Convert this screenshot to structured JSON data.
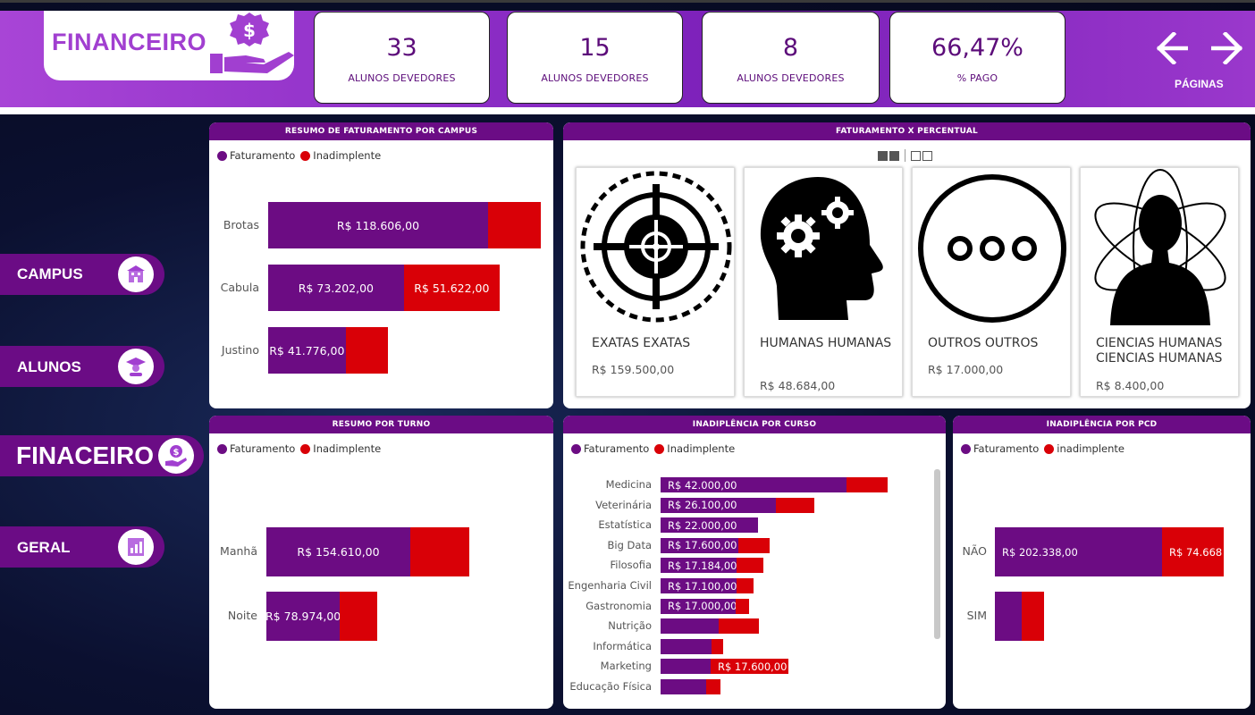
{
  "header": {
    "title": "FINANCEIRO",
    "kpis": [
      {
        "value": "33",
        "label": "ALUNOS DEVEDORES"
      },
      {
        "value": "15",
        "label": "ALUNOS DEVEDORES"
      },
      {
        "value": "8",
        "label": "ALUNOS DEVEDORES"
      },
      {
        "value": "66,47%",
        "label": "% PAGO"
      }
    ],
    "nav_label": "PÁGINAS"
  },
  "sidebar": {
    "items": [
      {
        "label": "CAMPUS",
        "icon": "building-icon"
      },
      {
        "label": "ALUNOS",
        "icon": "student-icon"
      },
      {
        "label": "FINACEIRO",
        "icon": "money-hand-icon"
      },
      {
        "label": "GERAL",
        "icon": "report-chart-icon"
      }
    ]
  },
  "colors": {
    "faturamento": "#6c0c83",
    "inadimplente": "#d90007",
    "header": "#6b0c85"
  },
  "campus_panel": {
    "title": "RESUMO DE FATURAMENTO POR CAMPUS",
    "legend": [
      "Faturamento",
      "Inadimplente"
    ]
  },
  "percent_panel": {
    "title": "FATURAMENTO X PERCENTUAL",
    "cards": [
      {
        "title": "EXATAS EXATAS",
        "value": "R$ 159.500,00",
        "icon": "target-icon"
      },
      {
        "title": "HUMANAS HUMANAS",
        "value": "R$ 48.684,00",
        "icon": "head-gears-icon"
      },
      {
        "title": "OUTROS OUTROS",
        "value": "R$ 17.000,00",
        "icon": "more-icon"
      },
      {
        "title": "CIENCIAS HUMANAS CIENCIAS HUMANAS",
        "value": "R$ 8.400,00",
        "icon": "atom-person-icon"
      }
    ]
  },
  "turno_panel": {
    "title": "RESUMO POR TURNO",
    "legend": [
      "Faturamento",
      "Inadimplente"
    ]
  },
  "curso_panel": {
    "title": "INADIPLÊNCIA POR CURSO",
    "legend": [
      "Faturamento",
      "Inadimplente"
    ]
  },
  "pcd_panel": {
    "title": "INADIPLÊNCIA POR PCD",
    "legend": [
      "Faturamento",
      "inadimplente"
    ]
  },
  "chart_data": [
    {
      "type": "bar",
      "title": "RESUMO DE FATURAMENTO POR CAMPUS",
      "categories": [
        "Brotas",
        "Cabula",
        "Justino"
      ],
      "series": [
        {
          "name": "Faturamento",
          "values": [
            118606,
            73202,
            41776
          ],
          "labels": [
            "R$ 118.606,00",
            "R$ 73.202,00",
            "R$ 41.776,00"
          ]
        },
        {
          "name": "Inadimplente",
          "values": [
            28500,
            51622,
            23000
          ],
          "labels": [
            "",
            "R$ 51.622,00",
            ""
          ]
        }
      ]
    },
    {
      "type": "bar",
      "title": "RESUMO POR TURNO",
      "categories": [
        "Manhã",
        "Noite"
      ],
      "series": [
        {
          "name": "Faturamento",
          "values": [
            154610,
            78974
          ],
          "labels": [
            "R$ 154.610,00",
            "R$ 78.974,00"
          ]
        },
        {
          "name": "Inadimplente",
          "values": [
            63000,
            40000
          ],
          "labels": [
            "",
            ""
          ]
        }
      ]
    },
    {
      "type": "bar",
      "title": "INADIPLÊNCIA POR CURSO",
      "categories": [
        "Medicina",
        "Veterinária",
        "Estatística",
        "Big Data",
        "Filosofia",
        "Engenharia Civil",
        "Gastronomia",
        "Nutrição",
        "Informática",
        "Marketing",
        "Educação Física"
      ],
      "series": [
        {
          "name": "Faturamento",
          "values": [
            42000,
            26100,
            22000,
            17600,
            17184,
            17100,
            17000,
            13200,
            11500,
            11300,
            10300
          ],
          "labels": [
            "R$ 42.000,00",
            "R$ 26.100,00",
            "R$ 22.000,00",
            "R$ 17.600,00",
            "R$ 17.184,00",
            "R$ 17.100,00",
            "R$ 17.000,00",
            "",
            "",
            "",
            ""
          ]
        },
        {
          "name": "Inadimplente",
          "values": [
            9300,
            8600,
            0,
            7100,
            6000,
            4000,
            3000,
            9000,
            2600,
            17600,
            3200
          ],
          "labels": [
            "",
            "",
            "",
            "",
            "",
            "",
            "",
            "",
            "",
            "R$ 17.600,00",
            ""
          ]
        }
      ]
    },
    {
      "type": "bar",
      "title": "INADIPLÊNCIA POR PCD",
      "categories": [
        "NÃO",
        "SIM"
      ],
      "series": [
        {
          "name": "Faturamento",
          "values": [
            202338,
            32000
          ],
          "labels": [
            "R$ 202.338,00",
            ""
          ]
        },
        {
          "name": "inadimplente",
          "values": [
            74668,
            28000
          ],
          "labels": [
            "R$ 74.668",
            ""
          ]
        }
      ]
    }
  ]
}
